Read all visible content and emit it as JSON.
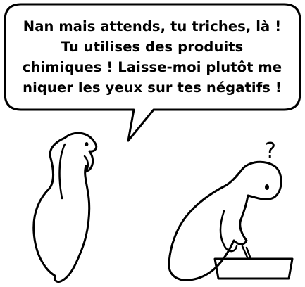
{
  "speech_bubble": {
    "lines": [
      "Nan mais attends, tu triches, là !",
      "Tu utilises des produits",
      "chimiques ! Laisse-moi plutôt me",
      "niquer les yeux sur tes négatifs !"
    ]
  },
  "thought_mark": "?",
  "colors": {
    "ink": "#000000",
    "background": "#ffffff"
  }
}
